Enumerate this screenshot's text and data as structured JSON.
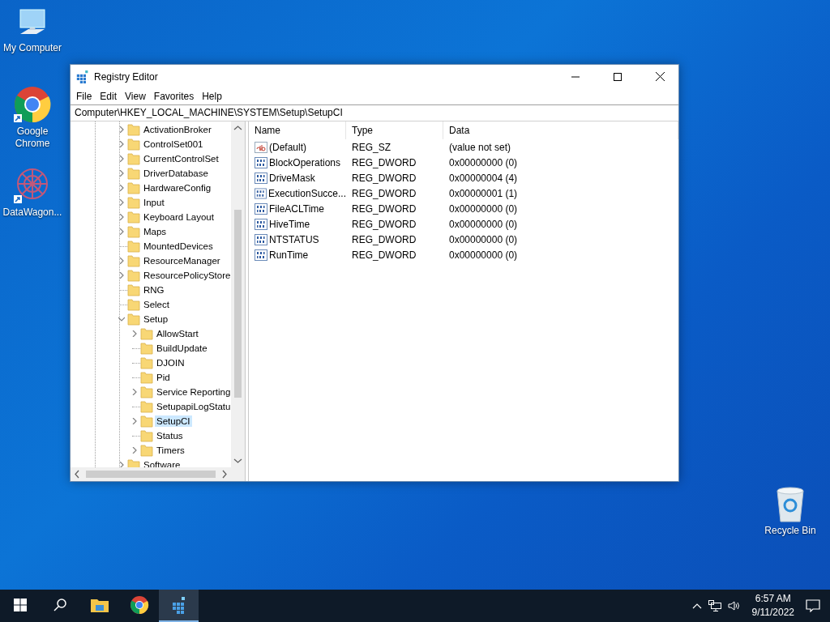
{
  "desktop_icons": [
    {
      "label": "My Computer",
      "kind": "computer"
    },
    {
      "label": "Google\nChrome",
      "kind": "chrome"
    },
    {
      "label": "DataWagon...",
      "kind": "datawagon"
    },
    {
      "label": "Recycle Bin",
      "kind": "recycle"
    }
  ],
  "window": {
    "title": "Registry Editor",
    "menu": [
      "File",
      "Edit",
      "View",
      "Favorites",
      "Help"
    ],
    "address": "Computer\\HKEY_LOCAL_MACHINE\\SYSTEM\\Setup\\SetupCI",
    "tree": [
      {
        "label": "ActivationBroker",
        "has_children": true,
        "selected": false
      },
      {
        "label": "ControlSet001",
        "has_children": true,
        "selected": false
      },
      {
        "label": "CurrentControlSet",
        "has_children": true,
        "selected": false
      },
      {
        "label": "DriverDatabase",
        "has_children": true,
        "selected": false
      },
      {
        "label": "HardwareConfig",
        "has_children": true,
        "selected": false
      },
      {
        "label": "Input",
        "has_children": true,
        "selected": false
      },
      {
        "label": "Keyboard Layout",
        "has_children": true,
        "selected": false
      },
      {
        "label": "Maps",
        "has_children": true,
        "selected": false
      },
      {
        "label": "MountedDevices",
        "has_children": false,
        "selected": false
      },
      {
        "label": "ResourceManager",
        "has_children": true,
        "selected": false
      },
      {
        "label": "ResourcePolicyStore",
        "has_children": true,
        "selected": false
      },
      {
        "label": "RNG",
        "has_children": false,
        "selected": false
      },
      {
        "label": "Select",
        "has_children": false,
        "selected": false
      },
      {
        "label": "Setup",
        "has_children": true,
        "expanded": true,
        "selected": false,
        "children": [
          {
            "label": "AllowStart",
            "has_children": true,
            "selected": false
          },
          {
            "label": "BuildUpdate",
            "has_children": false,
            "selected": false
          },
          {
            "label": "DJOIN",
            "has_children": false,
            "selected": false
          },
          {
            "label": "Pid",
            "has_children": false,
            "selected": false
          },
          {
            "label": "Service Reporting",
            "has_children": true,
            "selected": false
          },
          {
            "label": "SetupapiLogStatu",
            "has_children": false,
            "selected": false
          },
          {
            "label": "SetupCI",
            "has_children": true,
            "selected": true
          },
          {
            "label": "Status",
            "has_children": false,
            "selected": false
          },
          {
            "label": "Timers",
            "has_children": true,
            "selected": false
          }
        ]
      },
      {
        "label": "Software",
        "has_children": true,
        "selected": false
      }
    ],
    "columns": [
      "Name",
      "Type",
      "Data"
    ],
    "values": [
      {
        "name": "(Default)",
        "type": "REG_SZ",
        "data": "(value not set)",
        "kind": "string"
      },
      {
        "name": "BlockOperations",
        "type": "REG_DWORD",
        "data": "0x00000000 (0)",
        "kind": "binary"
      },
      {
        "name": "DriveMask",
        "type": "REG_DWORD",
        "data": "0x00000004 (4)",
        "kind": "binary"
      },
      {
        "name": "ExecutionSucce...",
        "type": "REG_DWORD",
        "data": "0x00000001 (1)",
        "kind": "binary"
      },
      {
        "name": "FileACLTime",
        "type": "REG_DWORD",
        "data": "0x00000000 (0)",
        "kind": "binary"
      },
      {
        "name": "HiveTime",
        "type": "REG_DWORD",
        "data": "0x00000000 (0)",
        "kind": "binary"
      },
      {
        "name": "NTSTATUS",
        "type": "REG_DWORD",
        "data": "0x00000000 (0)",
        "kind": "binary"
      },
      {
        "name": "RunTime",
        "type": "REG_DWORD",
        "data": "0x00000000 (0)",
        "kind": "binary"
      }
    ]
  },
  "taskbar": {
    "apps": [
      {
        "kind": "start",
        "selected": false
      },
      {
        "kind": "search",
        "selected": false
      },
      {
        "kind": "explorer",
        "selected": false
      },
      {
        "kind": "chrome",
        "selected": false
      },
      {
        "kind": "regedit",
        "selected": true
      }
    ],
    "time": "6:57 AM",
    "date": "9/11/2022"
  }
}
